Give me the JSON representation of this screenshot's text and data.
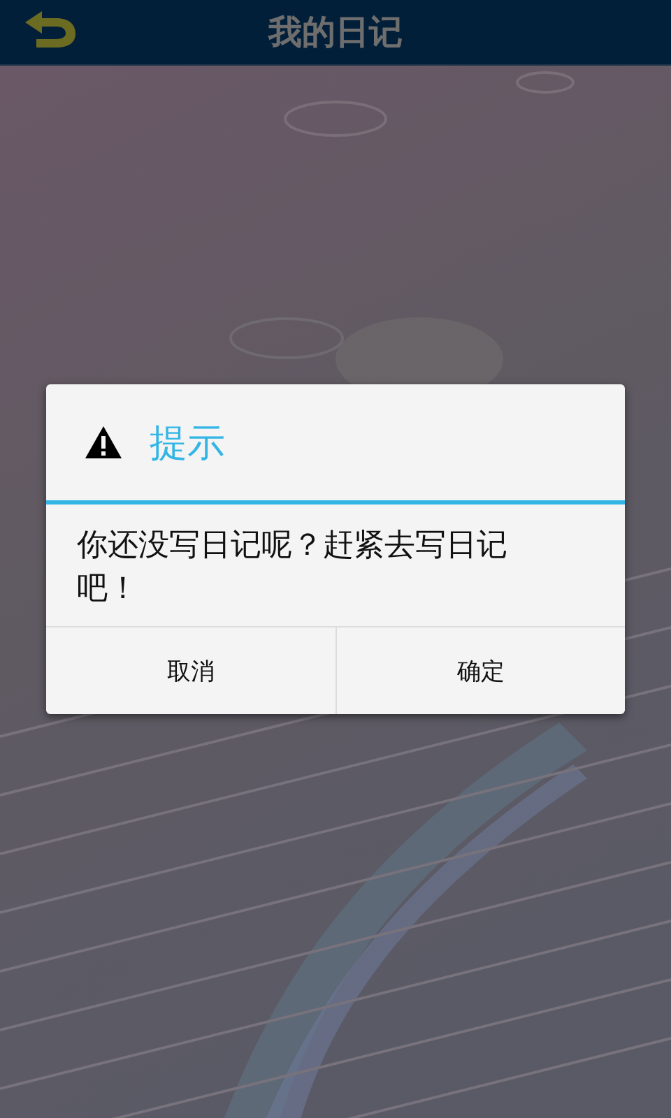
{
  "app_bar": {
    "title": "我的日记"
  },
  "dialog": {
    "title": "提示",
    "message": "你还没写日记呢？赶紧去写日记吧！",
    "buttons": [
      "取消",
      "确定"
    ]
  }
}
